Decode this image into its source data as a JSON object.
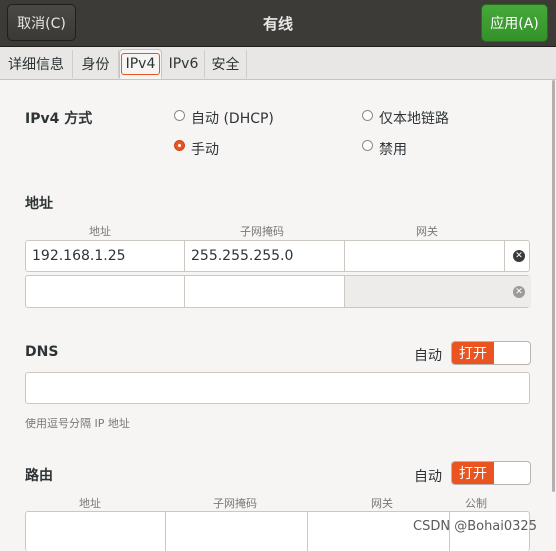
{
  "header": {
    "cancel_label": "取消(C)",
    "title": "有线",
    "apply_label": "应用(A)"
  },
  "tabs": [
    {
      "label": "详细信息"
    },
    {
      "label": "身份"
    },
    {
      "label": "IPv4"
    },
    {
      "label": "IPv6"
    },
    {
      "label": "安全"
    }
  ],
  "ipv4_method": {
    "label": "IPv4 方式",
    "options": [
      {
        "label": "自动 (DHCP)",
        "selected": false
      },
      {
        "label": "仅本地链路",
        "selected": false
      },
      {
        "label": "手动",
        "selected": true
      },
      {
        "label": "禁用",
        "selected": false
      }
    ]
  },
  "address": {
    "section_label": "地址",
    "columns": [
      "地址",
      "子网掩码",
      "网关"
    ],
    "rows": [
      [
        "192.168.1.25",
        "255.255.255.0",
        ""
      ],
      [
        "",
        "",
        ""
      ]
    ]
  },
  "dns": {
    "label": "DNS",
    "auto_label": "自动",
    "switch_label": "打开",
    "value": "",
    "hint": "使用逗号分隔 IP 地址"
  },
  "routes": {
    "label": "路由",
    "auto_label": "自动",
    "switch_label": "打开",
    "columns": [
      "地址",
      "子网掩码",
      "网关",
      "公制"
    ]
  },
  "watermark": "CSDN @Bohai0325",
  "colors": {
    "accent": "#e95420",
    "apply_green": "#3d9e30",
    "header_bg": "#3c3b37"
  }
}
